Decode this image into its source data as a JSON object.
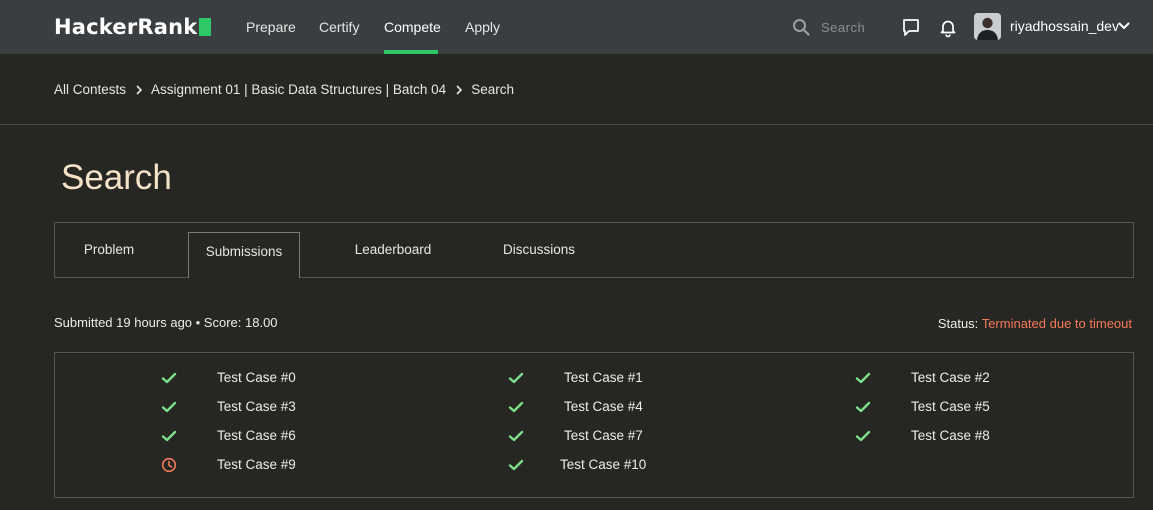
{
  "header": {
    "logo_text": "HackerRank",
    "nav": [
      "Prepare",
      "Certify",
      "Compete",
      "Apply"
    ],
    "active_nav": "Compete",
    "search_placeholder": "Search",
    "username": "riyadhossain_dev",
    "accent_color": "#2ec866"
  },
  "breadcrumb": [
    "All Contests",
    "Assignment 01 | Basic Data Structures | Batch 04",
    "Search"
  ],
  "page_title": "Search",
  "tabs": [
    "Problem",
    "Submissions",
    "Leaderboard",
    "Discussions"
  ],
  "active_tab": "Submissions",
  "submission": {
    "summary": "Submitted 19 hours ago • Score: 18.00",
    "status_label": "Status:",
    "status_value": "Terminated due to timeout",
    "status_color": "#f57b5a"
  },
  "test_cases": [
    {
      "label": "Test Case #0",
      "result": "passed"
    },
    {
      "label": "Test Case #1",
      "result": "passed"
    },
    {
      "label": "Test Case #2",
      "result": "passed"
    },
    {
      "label": "Test Case #3",
      "result": "passed"
    },
    {
      "label": "Test Case #4",
      "result": "passed"
    },
    {
      "label": "Test Case #5",
      "result": "passed"
    },
    {
      "label": "Test Case #6",
      "result": "passed"
    },
    {
      "label": "Test Case #7",
      "result": "passed"
    },
    {
      "label": "Test Case #8",
      "result": "passed"
    },
    {
      "label": "Test Case #9",
      "result": "timeout"
    },
    {
      "label": "Test Case #10",
      "result": "passed"
    }
  ]
}
